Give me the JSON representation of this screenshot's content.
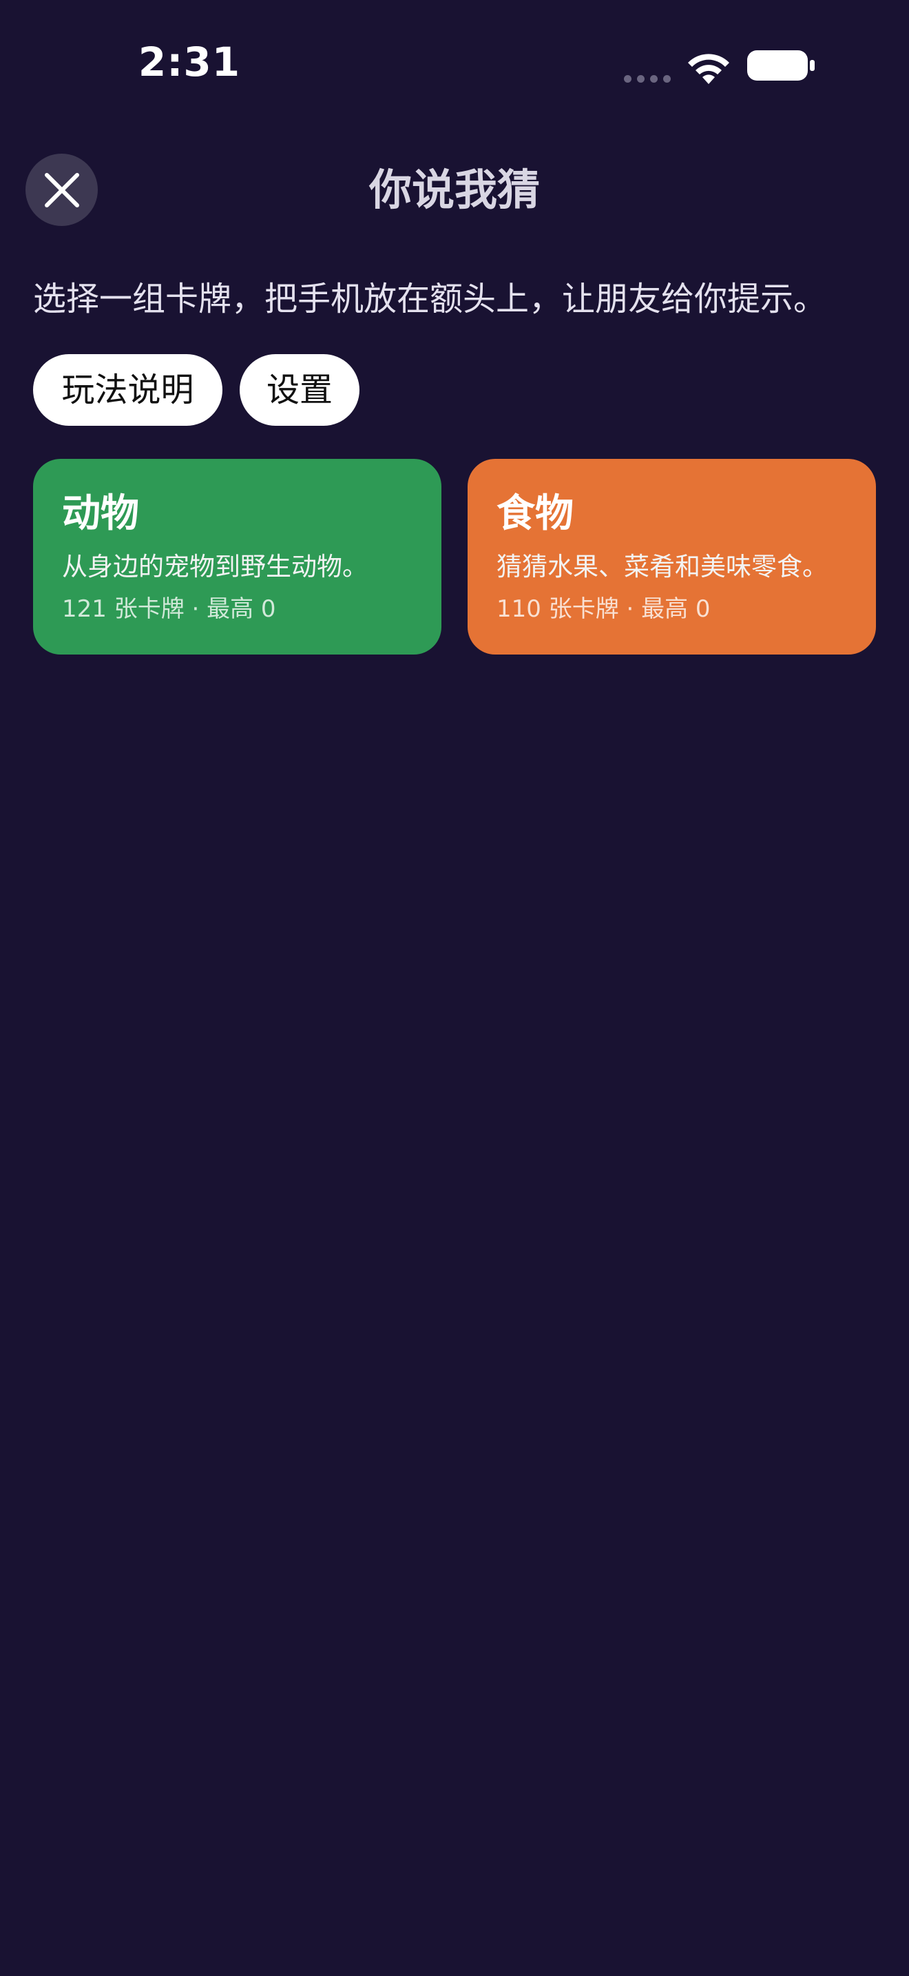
{
  "status_bar": {
    "time": "2:31",
    "icons": [
      "signal-icon",
      "wifi-icon",
      "battery-icon"
    ]
  },
  "header": {
    "title": "你说我猜",
    "close_icon": "close-icon"
  },
  "subtitle": "选择一组卡牌，把手机放在额头上，让朋友给你提示。",
  "buttons": {
    "rules_label": "玩法说明",
    "settings_label": "设置"
  },
  "decks": [
    {
      "title": "动物",
      "description": "从身边的宠物到野生动物。",
      "meta": "121 张卡牌 · 最高 0",
      "color": "#2e9a55"
    },
    {
      "title": "食物",
      "description": "猜猜水果、菜肴和美味零食。",
      "meta": "110 张卡牌 · 最高 0",
      "color": "#e57335"
    }
  ],
  "colors": {
    "background": "#191232",
    "close_button": "#3d3852",
    "pill": "#ffffff"
  }
}
